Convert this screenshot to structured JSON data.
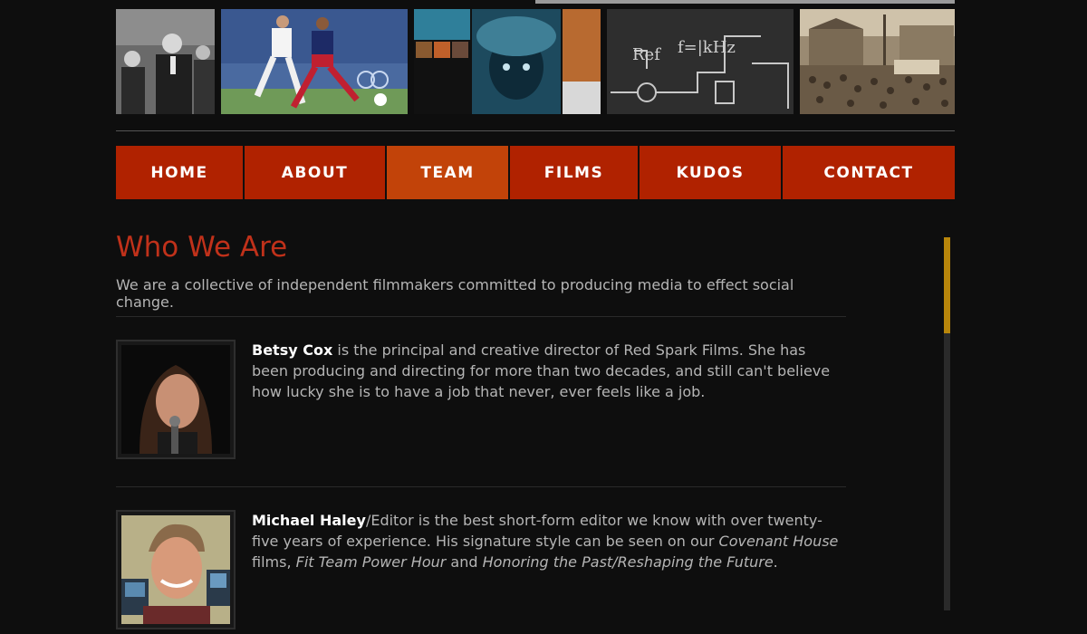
{
  "header": {
    "photos": [
      {
        "name": "photo-vintage-crowd-man"
      },
      {
        "name": "photo-soccer-players"
      },
      {
        "name": "photo-mosaic-portrait"
      },
      {
        "name": "photo-chalkboard-diagram"
      },
      {
        "name": "photo-sepia-town-square"
      }
    ]
  },
  "nav": {
    "items": [
      {
        "label": "HOME"
      },
      {
        "label": "ABOUT"
      },
      {
        "label": "TEAM"
      },
      {
        "label": "FILMS"
      },
      {
        "label": "KUDOS"
      },
      {
        "label": "CONTACT"
      }
    ],
    "active": "TEAM"
  },
  "main": {
    "title": "Who We Are",
    "intro": "We are a collective of independent filmmakers committed to producing media to effect social change.",
    "members": [
      {
        "name": "Betsy Cox",
        "bio_rest": " is the principal and creative director of Red Spark Films. She has been producing and directing for more than two decades, and still can't believe how lucky she is to have a job that never, ever feels like a job."
      },
      {
        "name": "Michael Haley",
        "bio_part1": "/Editor is the best short-form editor we know with over twenty-five years of experience. His signature style can be seen on our ",
        "film1": "Covenant House",
        "bio_part2": " films, ",
        "film2": "Fit Team Power Hour",
        "bio_part3": " and ",
        "film3": "Honoring the Past/Reshaping the Future",
        "bio_part4": "."
      }
    ]
  },
  "colors": {
    "background": "#0e0e0e",
    "nav_bg": "#b02200",
    "nav_active": "#c24309",
    "title": "#c0311a",
    "scroll_thumb": "#b8860b"
  }
}
